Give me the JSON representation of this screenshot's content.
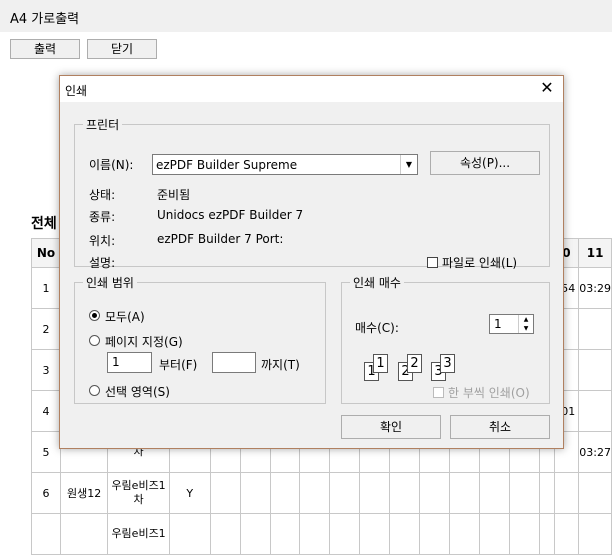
{
  "window": {
    "title": "A4 가로출력"
  },
  "toolbar": {
    "print_label": "출력",
    "close_label": "닫기"
  },
  "background": {
    "section_label": "전체",
    "header": [
      "No",
      "",
      "",
      "",
      "",
      "",
      "",
      "",
      "",
      "",
      "",
      "",
      "",
      "",
      "",
      "",
      "0",
      "11"
    ],
    "rows": [
      [
        "1",
        "",
        "",
        "",
        "",
        "",
        "",
        "",
        "",
        "",
        "",
        "",
        "",
        "",
        "",
        "",
        ":54",
        "03:29"
      ],
      [
        "2",
        "",
        "",
        "",
        "",
        "",
        "",
        "",
        "",
        "",
        "",
        "",
        "",
        "",
        "",
        "",
        "",
        ""
      ],
      [
        "3",
        "",
        "",
        "",
        "",
        "",
        "",
        "",
        "",
        "",
        "",
        "",
        "",
        "",
        "",
        "",
        "",
        ""
      ],
      [
        "4",
        "",
        "",
        "",
        "",
        "",
        "",
        "",
        "",
        "",
        "",
        "",
        "",
        "",
        "",
        "",
        ":01",
        ""
      ],
      [
        "5",
        "",
        "차",
        "",
        "",
        "",
        "",
        "",
        "",
        "",
        "",
        "",
        "",
        "",
        "",
        "",
        "",
        "03:27"
      ],
      [
        "6",
        "원생12",
        "우림e비즈1 차",
        "Y",
        "",
        "",
        "",
        "",
        "",
        "",
        "",
        "",
        "",
        "",
        "",
        "",
        "",
        ""
      ],
      [
        "",
        "",
        "우림e비즈1",
        "",
        "",
        "",
        "",
        "",
        "",
        "",
        "",
        "",
        "",
        "",
        "",
        "",
        "",
        ""
      ]
    ]
  },
  "dialog": {
    "title": "인쇄",
    "printer": {
      "group_label": "프린터",
      "name_label": "이름(N):",
      "name_value": "ezPDF Builder Supreme",
      "properties_button": "속성(P)...",
      "status_label": "상태:",
      "status_value": "준비됨",
      "type_label": "종류:",
      "type_value": "Unidocs ezPDF Builder 7",
      "location_label": "위치:",
      "location_value": "ezPDF Builder 7 Port:",
      "comment_label": "설명:",
      "print_to_file_label": "파일로 인쇄(L)",
      "print_to_file_checked": false
    },
    "range": {
      "group_label": "인쇄 범위",
      "all_label": "모두(A)",
      "pages_label": "페이지 지정(G)",
      "from_value": "1",
      "from_label": "부터(F)",
      "to_value": "",
      "to_label": "까지(T)",
      "selection_label": "선택 영역(S)",
      "selected": "all"
    },
    "copies": {
      "group_label": "인쇄 매수",
      "count_label": "매수(C):",
      "count_value": "1",
      "collate_label": "한 부씩 인쇄(O)",
      "collate_checked": false,
      "collate_enabled": false,
      "page_glyphs": [
        "1",
        "1",
        "2",
        "2",
        "3",
        "3"
      ]
    },
    "ok_button": "확인",
    "cancel_button": "취소"
  }
}
